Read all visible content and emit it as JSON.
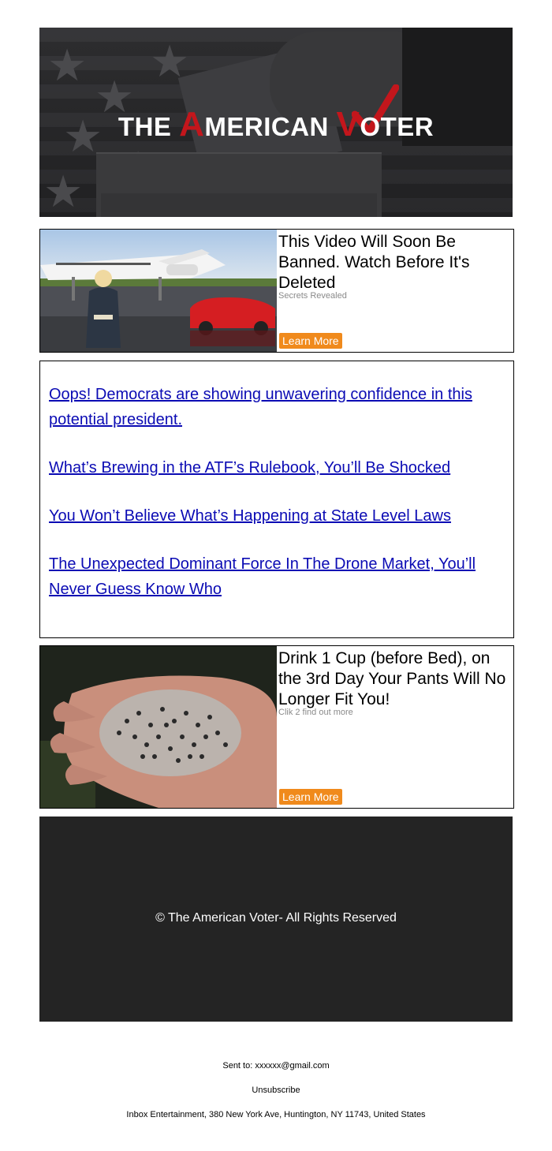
{
  "banner": {
    "logo_part1": "THE ",
    "logo_letter_a": "A",
    "logo_part2": "MERICAN ",
    "logo_letter_v": "V",
    "logo_part3": "OTER"
  },
  "ad1": {
    "title": "This Video Will Soon Be Banned. Watch Before It's Deleted",
    "subtitle": "Secrets Revealed",
    "button": "Learn More"
  },
  "links": [
    "Oops! Democrats are showing unwavering confidence in this potential president.",
    "What’s Brewing in the ATF’s Rulebook, You’ll Be Shocked",
    "You Won’t Believe What’s Happening at State Level Laws",
    "The Unexpected Dominant Force In The Drone Market, You’ll Never Guess Know Who"
  ],
  "ad2": {
    "title": "Drink 1 Cup (before Bed), on the 3rd Day Your Pants Will No Longer Fit You!",
    "subtitle": "Clik 2 find out more",
    "button": "Learn More"
  },
  "footer": {
    "copyright": "© The American Voter- All Rights Reserved",
    "sent_to": "Sent to: xxxxxx@gmail.com",
    "unsubscribe": "Unsubscribe",
    "address": "Inbox Entertainment, 380 New York Ave, Huntington, NY 11743, United States"
  },
  "colors": {
    "button": "#f08a1c",
    "link": "#0b0bb4",
    "logo_red": "#c3161c",
    "footer_bg": "#242424"
  }
}
